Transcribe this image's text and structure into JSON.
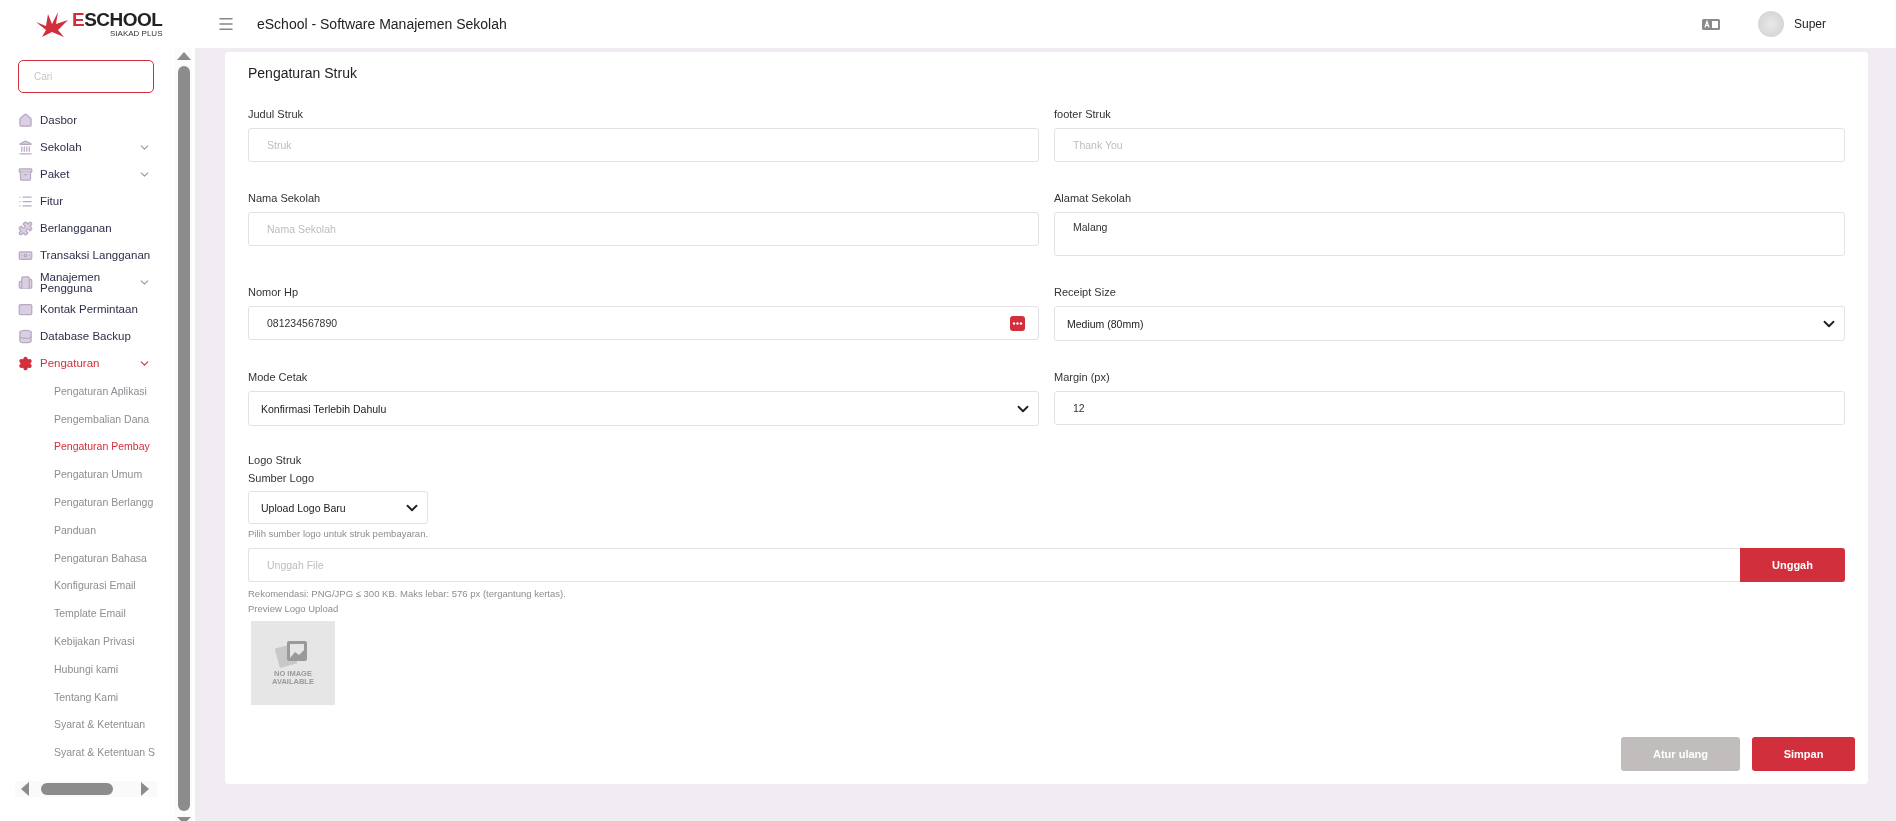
{
  "header": {
    "logo": {
      "name": "ESCHOOL",
      "tagline": "SIAKAD PLUS"
    },
    "title": "eSchool - Software Manajemen Sekolah",
    "user": {
      "name": "Super"
    }
  },
  "sidebar": {
    "search": {
      "placeholder": "Cari"
    },
    "items": [
      {
        "label": "Dasbor",
        "has_submenu": false,
        "selected": false
      },
      {
        "label": "Sekolah",
        "has_submenu": true,
        "selected": false
      },
      {
        "label": "Paket",
        "has_submenu": true,
        "selected": false
      },
      {
        "label": "Fitur",
        "has_submenu": false,
        "selected": false
      },
      {
        "label": "Berlangganan",
        "has_submenu": false,
        "selected": false
      },
      {
        "label": "Transaksi Langganan",
        "has_submenu": false,
        "selected": false
      },
      {
        "label": "Manajemen Pengguna",
        "has_submenu": true,
        "selected": false
      },
      {
        "label": "Kontak Permintaan",
        "has_submenu": false,
        "selected": false
      },
      {
        "label": "Database Backup",
        "has_submenu": false,
        "selected": false
      },
      {
        "label": "Pengaturan",
        "has_submenu": true,
        "selected": true,
        "children": [
          {
            "label": "Pengaturan Aplikasi",
            "selected": false
          },
          {
            "label": "Pengembalian Dana",
            "selected": false
          },
          {
            "label": "Pengaturan Pembay",
            "selected": true
          },
          {
            "label": "Pengaturan Umum",
            "selected": false
          },
          {
            "label": "Pengaturan Berlangg",
            "selected": false
          },
          {
            "label": "Panduan",
            "selected": false
          },
          {
            "label": "Pengaturan Bahasa",
            "selected": false
          },
          {
            "label": "Konfigurasi Email",
            "selected": false
          },
          {
            "label": "Template Email",
            "selected": false
          },
          {
            "label": "Kebijakan Privasi",
            "selected": false
          },
          {
            "label": "Hubungi kami",
            "selected": false
          },
          {
            "label": "Tentang Kami",
            "selected": false
          },
          {
            "label": "Syarat & Ketentuan",
            "selected": false
          },
          {
            "label": "Syarat & Ketentuan S",
            "selected": false
          }
        ]
      }
    ]
  },
  "page": {
    "title": "Pengaturan Struk",
    "fields": [
      {
        "kind": "text",
        "label": "Judul Struk",
        "placeholder": "Struk"
      },
      {
        "kind": "text",
        "label": "footer Struk",
        "placeholder": "Thank You"
      },
      {
        "kind": "text",
        "label": "Nama Sekolah",
        "placeholder": "Nama Sekolah"
      },
      {
        "kind": "textarea",
        "label": "Alamat Sekolah",
        "value": "Malang"
      },
      {
        "kind": "phone",
        "label": "Nomor Hp",
        "value": "081234567890"
      },
      {
        "kind": "select",
        "label": "Receipt Size",
        "value": "Medium (80mm)"
      },
      {
        "kind": "select",
        "label": "Mode Cetak",
        "value": "Konfirmasi Terlebih Dahulu"
      },
      {
        "kind": "text",
        "label": "Margin (px)",
        "value": "12"
      }
    ],
    "logo": {
      "title": "Logo Struk",
      "source_label": "Sumber Logo",
      "source_value": "Upload Logo Baru",
      "source_hint": "Pilih sumber logo untuk struk pembayaran.",
      "upload": {
        "placeholder": "Unggah File",
        "button": "Unggah"
      },
      "recommendation": "Rekomendasi: PNG/JPG ≤ 300 KB. Maks lebar: 576 px (tergantung kertas).",
      "preview_label": "Preview Logo Upload",
      "preview_placeholder": "NO IMAGE AVAILABLE"
    },
    "buttons": [
      {
        "label": "Atur ulang",
        "kind": "secondary"
      },
      {
        "label": "Simpan",
        "kind": "primary"
      }
    ]
  }
}
